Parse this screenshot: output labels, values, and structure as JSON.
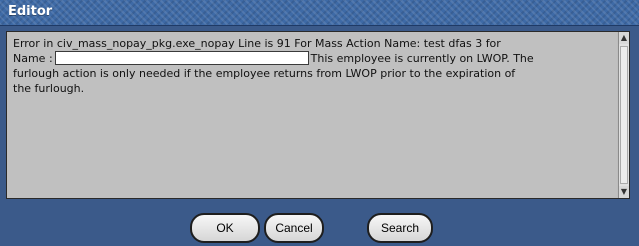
{
  "window": {
    "title": "Editor"
  },
  "editor": {
    "line1": "Error in civ_mass_nopay_pkg.exe_nopay Line is 91  For Mass Action Name: test dfas 3 for",
    "name_label": "Name :",
    "name_value": "",
    "after_field": "This employee is currently on LWOP. The",
    "line3": "furlough action is only needed if the employee returns from LWOP prior to the expiration of",
    "line4": "the furlough."
  },
  "scrollbar": {
    "up_icon": "▲",
    "down_icon": "▼"
  },
  "buttons": {
    "ok_label": "OK",
    "cancel_label": "Cancel",
    "search_label": "Search"
  },
  "colors": {
    "title_bar": "#3e6aa6",
    "background": "#3b5a8a",
    "editor_bg": "#c0c0c0"
  }
}
